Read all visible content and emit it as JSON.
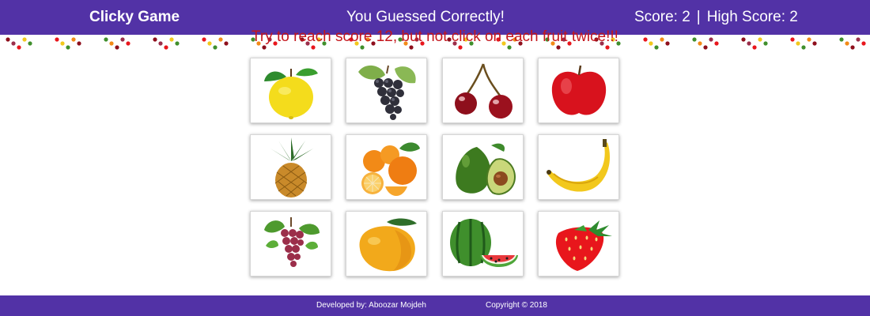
{
  "header": {
    "brand": "Clicky Game",
    "message": "You Guessed Correctly!",
    "score_label": "Score: 2",
    "separator": "|",
    "high_score_label": "High Score: 2"
  },
  "instruction": "Try to reach score 12, but not click on each fruit twice!!!",
  "cards": [
    {
      "name": "lemon",
      "icon": "lemon-icon"
    },
    {
      "name": "grapes-dark",
      "icon": "dark-grapes-icon"
    },
    {
      "name": "cherries",
      "icon": "cherries-icon"
    },
    {
      "name": "apple",
      "icon": "apple-icon"
    },
    {
      "name": "pineapple",
      "icon": "pineapple-icon"
    },
    {
      "name": "orange",
      "icon": "orange-icon"
    },
    {
      "name": "avocado",
      "icon": "avocado-icon"
    },
    {
      "name": "banana",
      "icon": "banana-icon"
    },
    {
      "name": "red-grapes",
      "icon": "red-grapes-icon"
    },
    {
      "name": "mango",
      "icon": "mango-icon"
    },
    {
      "name": "watermelon",
      "icon": "watermelon-icon"
    },
    {
      "name": "strawberry",
      "icon": "strawberry-icon"
    }
  ],
  "footer": {
    "developer": "Developed by: Aboozar Mojdeh",
    "copyright": "Copyright © 2018"
  },
  "colors": {
    "nav": "#5232a6",
    "instruction_text": "#c4161c"
  }
}
